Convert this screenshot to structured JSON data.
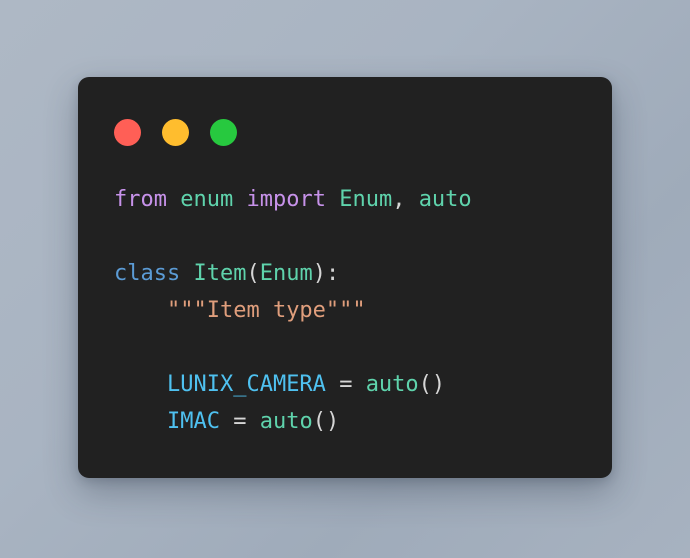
{
  "background": {
    "gradient_from": "#aeb8c5",
    "gradient_to": "#a7b2c0"
  },
  "card": {
    "background_color": "#212121",
    "corner_radius": "11px"
  },
  "window_controls": {
    "close_color": "#ff5f56",
    "minimize_color": "#ffbd2e",
    "maximize_color": "#27c93f",
    "close_label": "close-dot",
    "minimize_label": "minimize-dot",
    "maximize_label": "maximize-dot"
  },
  "syntax_colors": {
    "keyword": "#c792ea",
    "declaration": "#5b9bd5",
    "name": "#5fd3ac",
    "constant": "#4fc1f0",
    "docstring": "#e09e7c",
    "punctuation": "#d6d6d6"
  },
  "code": {
    "language": "python",
    "full_text": "from enum import Enum, auto\n\nclass Item(Enum):\n    \"\"\"Item type\"\"\"\n\n    LUNIX_CAMERA = auto()\n    IMAC = auto()",
    "lines": [
      {
        "index": 1,
        "text": "from enum import Enum, auto",
        "tokens": [
          {
            "t": "from",
            "c": "keyword"
          },
          {
            "t": " ",
            "c": "plain"
          },
          {
            "t": "enum",
            "c": "name"
          },
          {
            "t": " ",
            "c": "plain"
          },
          {
            "t": "import",
            "c": "keyword"
          },
          {
            "t": " ",
            "c": "plain"
          },
          {
            "t": "Enum",
            "c": "name"
          },
          {
            "t": ",",
            "c": "punct"
          },
          {
            "t": " ",
            "c": "plain"
          },
          {
            "t": "auto",
            "c": "name"
          }
        ]
      },
      {
        "index": 2,
        "text": "",
        "tokens": []
      },
      {
        "index": 3,
        "text": "class Item(Enum):",
        "tokens": [
          {
            "t": "class",
            "c": "declaration"
          },
          {
            "t": " ",
            "c": "plain"
          },
          {
            "t": "Item",
            "c": "name"
          },
          {
            "t": "(",
            "c": "punct"
          },
          {
            "t": "Enum",
            "c": "name"
          },
          {
            "t": ")",
            "c": "punct"
          },
          {
            "t": ":",
            "c": "punct"
          }
        ]
      },
      {
        "index": 4,
        "text": "    \"\"\"Item type\"\"\"",
        "tokens": [
          {
            "t": "    ",
            "c": "plain"
          },
          {
            "t": "\"\"\"Item type\"\"\"",
            "c": "docstring"
          }
        ]
      },
      {
        "index": 5,
        "text": "",
        "tokens": []
      },
      {
        "index": 6,
        "text": "    LUNIX_CAMERA = auto()",
        "tokens": [
          {
            "t": "    ",
            "c": "plain"
          },
          {
            "t": "LUNIX_CAMERA",
            "c": "constant"
          },
          {
            "t": " ",
            "c": "plain"
          },
          {
            "t": "=",
            "c": "operator"
          },
          {
            "t": " ",
            "c": "plain"
          },
          {
            "t": "auto",
            "c": "name"
          },
          {
            "t": "(",
            "c": "punct"
          },
          {
            "t": ")",
            "c": "punct"
          }
        ]
      },
      {
        "index": 7,
        "text": "    IMAC = auto()",
        "tokens": [
          {
            "t": "    ",
            "c": "plain"
          },
          {
            "t": "IMAC",
            "c": "constant"
          },
          {
            "t": " ",
            "c": "plain"
          },
          {
            "t": "=",
            "c": "operator"
          },
          {
            "t": " ",
            "c": "plain"
          },
          {
            "t": "auto",
            "c": "name"
          },
          {
            "t": "(",
            "c": "punct"
          },
          {
            "t": ")",
            "c": "punct"
          }
        ]
      }
    ]
  }
}
